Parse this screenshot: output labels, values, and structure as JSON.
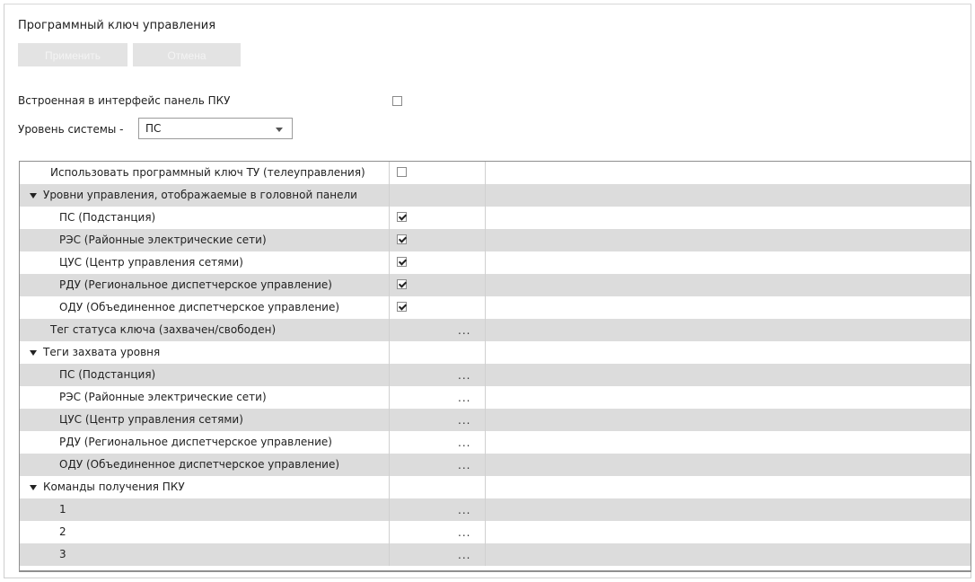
{
  "panel": {
    "title": "Программный ключ управления",
    "apply_label": "Применить",
    "cancel_label": "Отмена",
    "embedded_panel_label": "Встроенная в интерфейс панель ПКУ",
    "embedded_panel_checked": false,
    "system_level_label": "Уровень системы -",
    "system_level_value": "ПС"
  },
  "grid": {
    "rows": [
      {
        "label": "Использовать программный ключ ТУ (телеуправления)",
        "level": 0,
        "expander": false,
        "value": "checkbox",
        "checked": false
      },
      {
        "label": "Уровни управления, отображаемые в головной панели",
        "level": 0,
        "expander": true,
        "value": "none"
      },
      {
        "label": "ПС (Подстанция)",
        "level": 1,
        "expander": false,
        "value": "checkbox",
        "checked": true
      },
      {
        "label": "РЭС (Районные электрические сети)",
        "level": 1,
        "expander": false,
        "value": "checkbox",
        "checked": true
      },
      {
        "label": "ЦУС (Центр управления сетями)",
        "level": 1,
        "expander": false,
        "value": "checkbox",
        "checked": true
      },
      {
        "label": "РДУ (Региональное диспетчерское управление)",
        "level": 1,
        "expander": false,
        "value": "checkbox",
        "checked": true
      },
      {
        "label": "ОДУ (Объединенное диспетчерское управление)",
        "level": 1,
        "expander": false,
        "value": "checkbox",
        "checked": true
      },
      {
        "label": "Тег статуса ключа (захвачен/свободен)",
        "level": 0,
        "expander": false,
        "value": "ellipsis"
      },
      {
        "label": "Теги захвата уровня",
        "level": 0,
        "expander": true,
        "value": "none"
      },
      {
        "label": "ПС (Подстанция)",
        "level": 1,
        "expander": false,
        "value": "ellipsis"
      },
      {
        "label": "РЭС (Районные электрические сети)",
        "level": 1,
        "expander": false,
        "value": "ellipsis"
      },
      {
        "label": "ЦУС (Центр управления сетями)",
        "level": 1,
        "expander": false,
        "value": "ellipsis"
      },
      {
        "label": "РДУ (Региональное диспетчерское управление)",
        "level": 1,
        "expander": false,
        "value": "ellipsis"
      },
      {
        "label": "ОДУ (Объединенное диспетчерское управление)",
        "level": 1,
        "expander": false,
        "value": "ellipsis"
      },
      {
        "label": "Команды получения ПКУ",
        "level": 0,
        "expander": true,
        "value": "none"
      },
      {
        "label": "1",
        "level": 1,
        "expander": false,
        "value": "ellipsis"
      },
      {
        "label": "2",
        "level": 1,
        "expander": false,
        "value": "ellipsis"
      },
      {
        "label": "3",
        "level": 1,
        "expander": false,
        "value": "ellipsis"
      }
    ],
    "ellipsis_text": "..."
  },
  "colors": {
    "row_alt": "#dcdcdc",
    "button_disabled_bg": "#e3e3e3",
    "grid_border": "#8f8f8f"
  },
  "icons": {
    "expander": "triangle-down-icon",
    "dropdown": "chevron-down-icon"
  }
}
